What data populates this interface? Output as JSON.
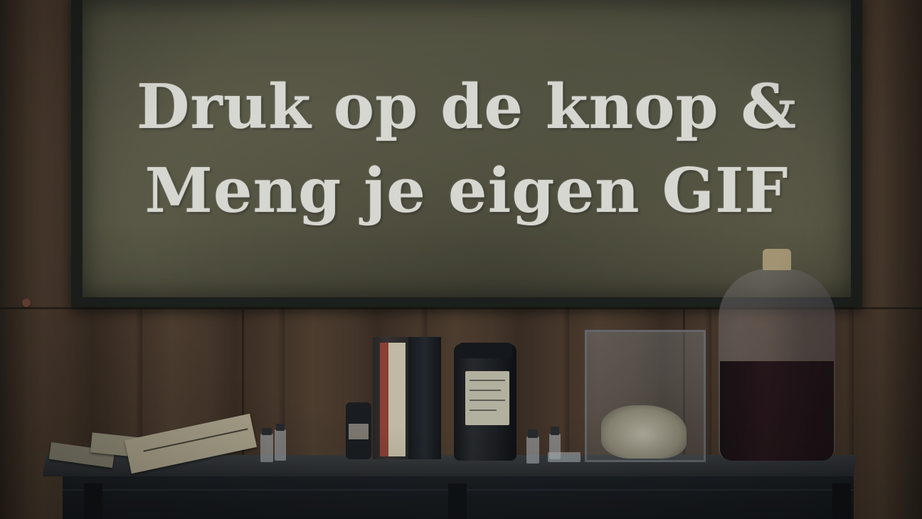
{
  "board": {
    "line1": "Druk op de knop &",
    "line2": "Meng je eigen GIF"
  },
  "colors": {
    "board": "#5c5945",
    "chalk_text": "#f2efe6",
    "wood_wall": "#4a3628",
    "shelf": "#2a2b2d"
  }
}
